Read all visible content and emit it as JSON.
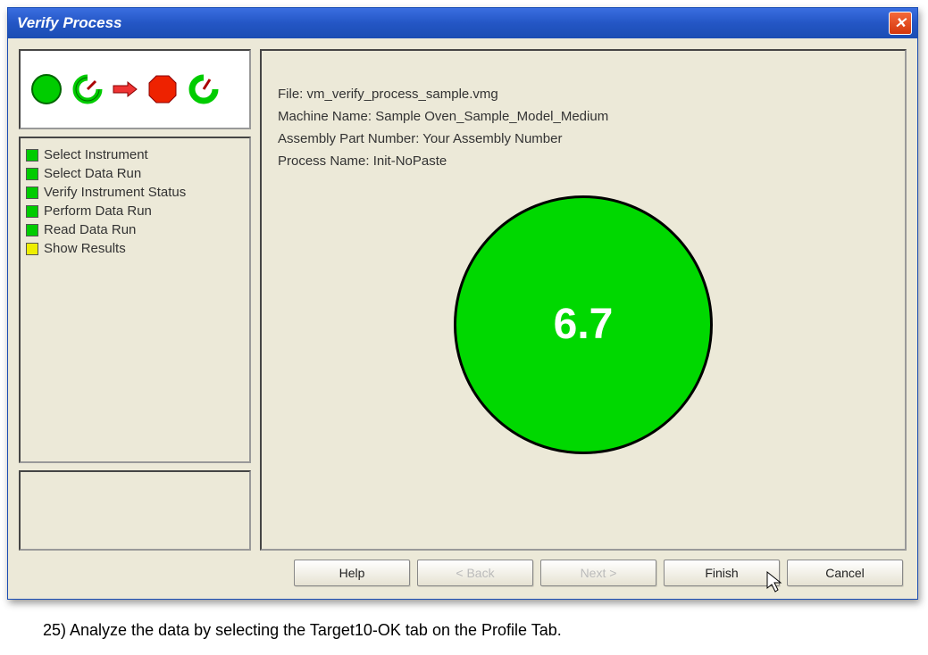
{
  "window": {
    "title": "Verify Process"
  },
  "steps": [
    {
      "label": "Select Instrument",
      "status": "green"
    },
    {
      "label": "Select Data Run",
      "status": "green"
    },
    {
      "label": "Verify Instrument Status",
      "status": "green"
    },
    {
      "label": "Perform Data Run",
      "status": "green"
    },
    {
      "label": "Read Data Run",
      "status": "green"
    },
    {
      "label": "Show Results",
      "status": "yellow"
    }
  ],
  "info": {
    "file_label": "File:",
    "file_value": "vm_verify_process_sample.vmg",
    "machine_label": "Machine Name:",
    "machine_value": "Sample Oven_Sample_Model_Medium",
    "assembly_label": "Assembly Part Number:",
    "assembly_value": "Your Assembly Number",
    "process_label": "Process Name:",
    "process_value": "Init-NoPaste"
  },
  "result": {
    "value": "6.7",
    "color": "#00d800"
  },
  "buttons": {
    "help": "Help",
    "back": "< Back",
    "next": "Next >",
    "finish": "Finish",
    "cancel": "Cancel"
  },
  "caption": "25) Analyze the data by selecting the Target10-OK tab on the Profile Tab."
}
